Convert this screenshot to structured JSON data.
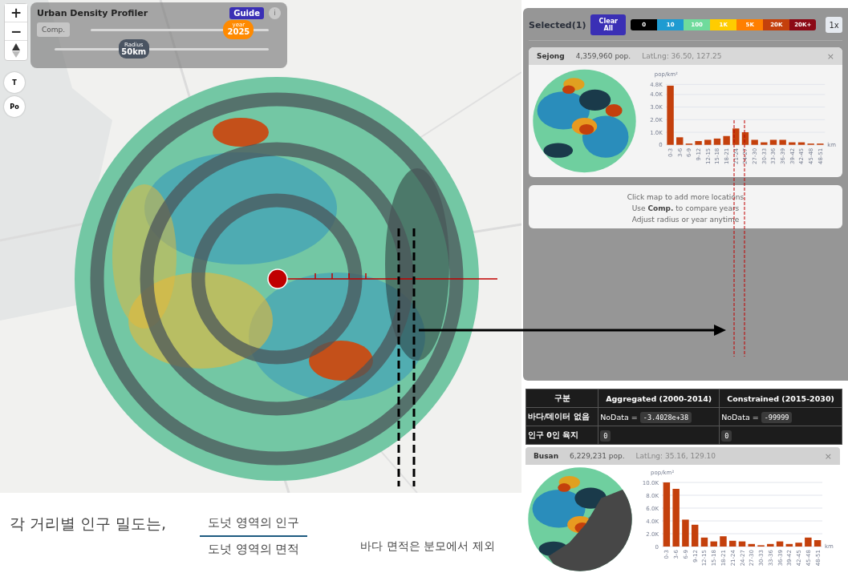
{
  "map_controls": {
    "zoom_in": "+",
    "zoom_out": "−"
  },
  "profiler": {
    "title": "Urban Density Profiler",
    "guide_button": "Guide",
    "info_button": "i",
    "compare_button": "Comp.",
    "year_slider": {
      "label": "year",
      "value": "2025",
      "level": 0.83
    },
    "radius_slider": {
      "label": "Radius",
      "value": "50km",
      "level": 0.37
    }
  },
  "side_buttons": [
    "T",
    "Po"
  ],
  "selection": {
    "title": "Selected(1)",
    "clear_button": "Clear All",
    "zoom_button": "1x",
    "legend": [
      {
        "label": "0",
        "color": "#000000"
      },
      {
        "label": "10",
        "color": "#1f9bd1"
      },
      {
        "label": "100",
        "color": "#6fdb9c"
      },
      {
        "label": "1K",
        "color": "#ffcc00"
      },
      {
        "label": "5K",
        "color": "#ff7f00"
      },
      {
        "label": "20K",
        "color": "#c4400c"
      },
      {
        "label": "20K+",
        "color": "#8c0a16"
      }
    ],
    "cards": [
      {
        "name": "Sejong",
        "population": "4,359,960 pop.",
        "latlng": "LatLng: 36.50, 127.25",
        "close": "×",
        "chart_data": {
          "type": "bar",
          "ylabel": "pop/km²",
          "xlabel": "km",
          "categories": [
            "0-3",
            "3-6",
            "6-9",
            "9-12",
            "12-15",
            "15-18",
            "18-21",
            "21-24",
            "24-27",
            "27-30",
            "30-33",
            "33-36",
            "36-39",
            "39-42",
            "42-45",
            "45-48",
            "48-51"
          ],
          "values": [
            4700,
            600,
            100,
            300,
            400,
            500,
            700,
            1300,
            1000,
            400,
            200,
            400,
            400,
            200,
            200,
            100,
            100
          ],
          "ylim": [
            0,
            4800
          ],
          "grid": true,
          "yticks": [
            {
              "value": 0,
              "label": "0"
            },
            {
              "value": 1000,
              "label": "1.0K"
            },
            {
              "value": 2000,
              "label": "2.0K"
            },
            {
              "value": 3000,
              "label": "3.0K"
            },
            {
              "value": 4000,
              "label": "4.0K"
            },
            {
              "value": 4800,
              "label": "4.8K"
            }
          ]
        }
      }
    ],
    "hints": [
      "Click map to add more locations",
      "Use **Comp.** to compare years",
      "Adjust radius or year anytime"
    ]
  },
  "table": {
    "columns": [
      "구분",
      "Aggregated (2000-2014)",
      "Constrained (2015-2030)"
    ],
    "rows": [
      [
        {
          "text": "바다/데이터 없음"
        },
        {
          "text": "NoData =",
          "code": "-3.4028e+38"
        },
        {
          "text": "NoData =",
          "code": "-99999"
        }
      ],
      [
        {
          "text": "인구 0인 육지"
        },
        {
          "code": "0"
        },
        {
          "code": "0"
        }
      ]
    ]
  },
  "second_card": {
    "name": "Busan",
    "population": "6,229,231 pop.",
    "latlng": "LatLng: 35.16, 129.10",
    "close": "×",
    "chart_data": {
      "type": "bar",
      "ylabel": "pop/km²",
      "xlabel": "km",
      "categories": [
        "0-3",
        "3-6",
        "6-9",
        "9-12",
        "12-15",
        "15-18",
        "18-21",
        "21-24",
        "24-27",
        "27-30",
        "30-33",
        "33-36",
        "36-39",
        "39-42",
        "42-45",
        "45-48",
        "48-51"
      ],
      "values": [
        10000,
        9000,
        4200,
        3400,
        1400,
        800,
        1600,
        900,
        800,
        400,
        200,
        400,
        800,
        400,
        600,
        1400,
        1000
      ],
      "ylim": [
        0,
        10000
      ],
      "grid": true,
      "yticks": [
        {
          "value": 0,
          "label": "0"
        },
        {
          "value": 2000,
          "label": "2.0K"
        },
        {
          "value": 4000,
          "label": "4.0K"
        },
        {
          "value": 6000,
          "label": "6.0K"
        },
        {
          "value": 8000,
          "label": "8.0K"
        },
        {
          "value": 10000,
          "label": "10.0K"
        }
      ]
    }
  },
  "formula": {
    "lead": "각 거리별 인구 밀도는,",
    "numerator": "도넛 영역의 인구",
    "denominator": "도넛 영역의 면적",
    "note": "바다 면적은 분모에서 제외"
  }
}
